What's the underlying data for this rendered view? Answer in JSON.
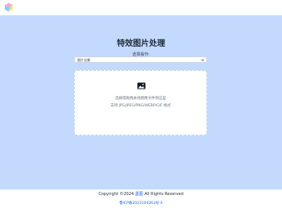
{
  "header": {
    "logo_icon": "colorful-cube-logo"
  },
  "main": {
    "title": "特效图片处理",
    "select_label": "选择操作:",
    "select_value": "图片去雾",
    "upload": {
      "icon": "image-icon",
      "line1": "选择或拖拽本地图像文件到这里",
      "line2": "支持 JPG/JPEG/PNG/WEBP/GIF 格式"
    }
  },
  "footer": {
    "copyright_prefix": "Copyright ©2024",
    "copyright_link": "墨图",
    "copyright_suffix": "All Rights Reserved",
    "icp": "鲁ICP备2023104263号-4"
  },
  "colors": {
    "background": "#c3dafe",
    "link": "#2563eb"
  }
}
